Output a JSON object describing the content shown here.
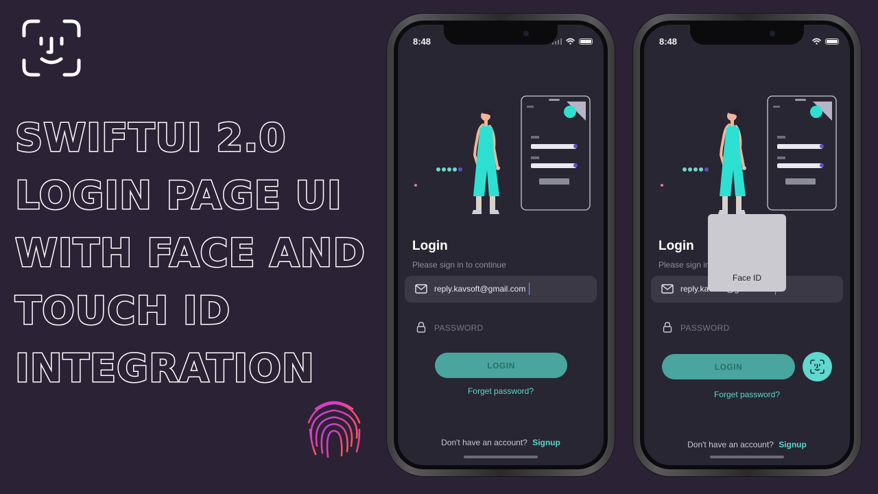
{
  "headline": {
    "lines": [
      "SwiftUI 2.0",
      "Login Page UI",
      "With Face And",
      "Touch ID",
      "Integration"
    ]
  },
  "icons": {
    "top_left": "face-id-icon",
    "bottom": "fingerprint-icon"
  },
  "colors": {
    "background": "#2b2235",
    "screen": "#282632",
    "accent": "#5ed6cd",
    "button": "#4aa59f",
    "fingerprint_gradient": [
      "#e14bd8",
      "#ff5a4e"
    ]
  },
  "phones": [
    {
      "status_time": "8:48",
      "login_title": "Login",
      "login_subtitle": "Please sign in to continue",
      "email_value": "reply.kavsoft@gmail.com",
      "password_placeholder": "PASSWORD",
      "login_button": "LOGIN",
      "forgot_password": "Forget password?",
      "signup_prompt": "Don't have an account?",
      "signup_link": "Signup"
    },
    {
      "status_time": "8:48",
      "login_title": "Login",
      "login_subtitle": "Please sign in to continue",
      "email_value": "reply.kavsoft@gmail.com",
      "password_placeholder": "PASSWORD",
      "login_button": "LOGIN",
      "forgot_password": "Forget password?",
      "signup_prompt": "Don't have an account?",
      "signup_link": "Signup",
      "faceid_overlay_label": "Face ID",
      "faceid_button_icon": "face-id-icon"
    }
  ]
}
